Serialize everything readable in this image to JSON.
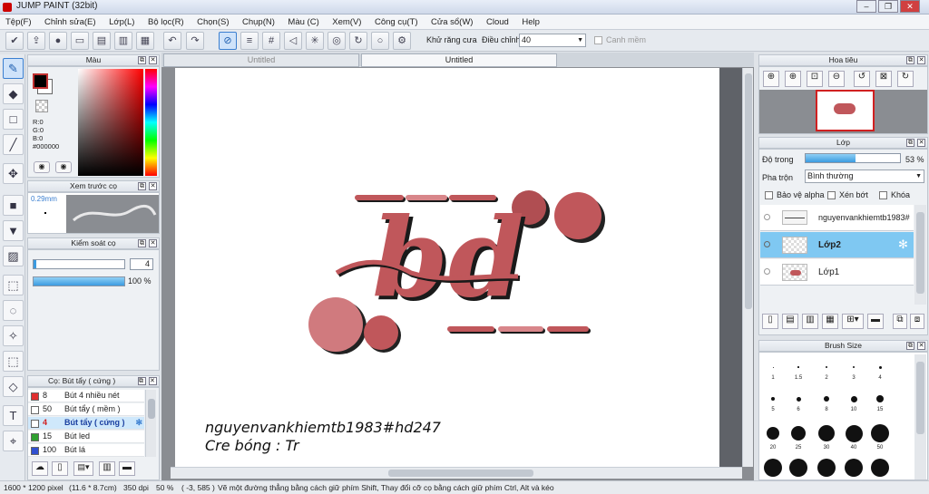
{
  "app": {
    "title": "JUMP PAINT (32bit)"
  },
  "menu": [
    "Tệp(F)",
    "Chỉnh sửa(E)",
    "Lớp(L)",
    "Bộ lọc(R)",
    "Chọn(S)",
    "Chụp(N)",
    "Màu (C)",
    "Xem(V)",
    "Công cụ(T)",
    "Cửa sổ(W)",
    "Cloud",
    "Help"
  ],
  "toolbar": {
    "antialias_label": "Khử răng cưa",
    "adjust_label": "Điều chỉnh",
    "adjust_value": "40",
    "snap_label": "Canh mềm"
  },
  "color_panel": {
    "title": "Màu",
    "r": "R:0",
    "g": "G:0",
    "b": "B:0",
    "hex": "#000000"
  },
  "brush_preview": {
    "title": "Xem trước cọ",
    "size": "0.29mm"
  },
  "brush_control": {
    "title": "Kiểm soát cọ",
    "size_value": "4",
    "opacity_value": "100 %"
  },
  "brush_list": {
    "title": "Cọ: Bút tẩy ( cứng )",
    "items": [
      {
        "size": "8",
        "name": "Bút 4 nhiều nét",
        "color": "#e03030"
      },
      {
        "size": "50",
        "name": "Bút tẩy ( mềm )",
        "color": "#ffffff"
      },
      {
        "size": "4",
        "name": "Bút tẩy ( cứng )",
        "color": "#ffffff"
      },
      {
        "size": "15",
        "name": "Bút led",
        "color": "#30a030"
      },
      {
        "size": "100",
        "name": "Bút lá",
        "color": "#3050d0"
      }
    ]
  },
  "tabs": [
    "Untitled",
    "Untitled"
  ],
  "canvas": {
    "lettering": "bd",
    "caption_line1": "nguyenvankhiemtb1983#hd247",
    "caption_line2": "Cre bóng : Tr",
    "accent": "#c0575b"
  },
  "navigator": {
    "title": "Hoa tiêu"
  },
  "layer_panel": {
    "title": "Lớp",
    "opacity_label": "Độ trong",
    "opacity_value": "53 %",
    "opacity_fraction": 0.53,
    "blend_label": "Pha trộn",
    "blend_value": "Bình thường",
    "protect_alpha": "Bảo vệ alpha",
    "clip": "Xén bớt",
    "lock": "Khóa",
    "layers": [
      "nguyenvankhiemtb1983#",
      "Lớp2",
      "Lớp1"
    ]
  },
  "brush_size": {
    "title": "Brush Size",
    "labels": [
      "1",
      "1.5",
      "2",
      "3",
      "4",
      "5",
      "6",
      "8",
      "10",
      "15",
      "20",
      "25",
      "30",
      "40",
      "50"
    ]
  },
  "status": {
    "size": "1600 * 1200 pixel",
    "cm": "(11.6 * 8.7cm)",
    "dpi": "350 dpi",
    "zoom": "50 %",
    "coords": "( -3, 585 )",
    "hint": "Vẽ một đường thẳng bằng cách giữ phím Shift, Thay đổi cỡ cọ bằng cách giữ phím Ctrl, Alt và kéo"
  }
}
